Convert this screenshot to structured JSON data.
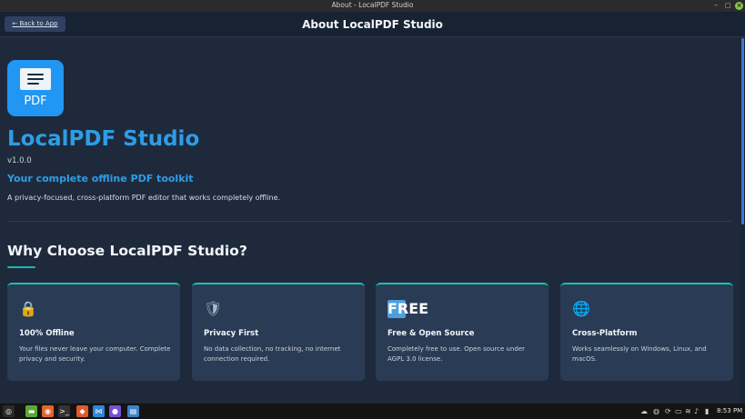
{
  "window": {
    "title": "About - LocalPDF Studio",
    "minimize_glyph": "–",
    "maximize_glyph": "□",
    "close_glyph": "×"
  },
  "header": {
    "back_label": "← Back to App",
    "title": "About LocalPDF Studio"
  },
  "about": {
    "logo_label": "PDF",
    "app_name": "LocalPDF Studio",
    "version": "v1.0.0",
    "tagline": "Your complete offline PDF toolkit",
    "description": "A privacy-focused, cross-platform PDF editor that works completely offline."
  },
  "why": {
    "heading": "Why Choose LocalPDF Studio?",
    "cards": [
      {
        "icon": "lock-icon",
        "glyph": "🔒",
        "title": "100% Offline",
        "text": "Your files never leave your computer. Complete privacy and security."
      },
      {
        "icon": "shield-icon",
        "glyph": "🛡",
        "title": "Privacy First",
        "text": "No data collection, no tracking, no internet connection required."
      },
      {
        "icon": "free-badge-icon",
        "glyph": "FREE",
        "title": "Free & Open Source",
        "text": "Completely free to use. Open source under AGPL 3.0 license."
      },
      {
        "icon": "globe-icon",
        "glyph": "🌐",
        "title": "Cross-Platform",
        "text": "Works seamlessly on Windows, Linux, and macOS."
      }
    ]
  },
  "taskbar": {
    "clock": "8:53 PM",
    "apps": [
      {
        "name": "menu-icon",
        "glyph": "◎",
        "color": "#2a2a2a"
      },
      {
        "name": "files-icon",
        "glyph": "▬",
        "color": "#5aa832"
      },
      {
        "name": "firefox-icon",
        "glyph": "◉",
        "color": "#e4642a"
      },
      {
        "name": "terminal-icon",
        "glyph": ">_",
        "color": "#333333"
      },
      {
        "name": "brave-icon",
        "glyph": "◆",
        "color": "#e3572d"
      },
      {
        "name": "vscode-icon",
        "glyph": "⋈",
        "color": "#2f86d8"
      },
      {
        "name": "github-icon",
        "glyph": "●",
        "color": "#7b4fd6"
      },
      {
        "name": "localpdf-taskbar-icon",
        "glyph": "▤",
        "color": "#3a83c9"
      }
    ]
  },
  "colors": {
    "accent": "#2e9de6",
    "card_border": "#18c2b3",
    "background": "#1e2a3c"
  }
}
